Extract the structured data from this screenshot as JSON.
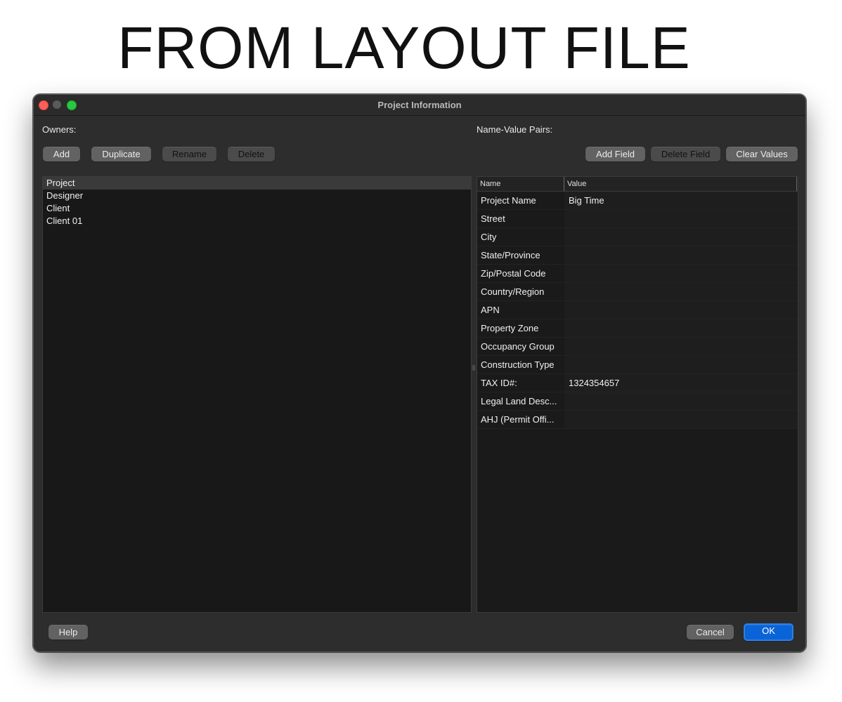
{
  "headline": "FROM LAYOUT FILE",
  "window": {
    "title": "Project Information"
  },
  "owners": {
    "label": "Owners:",
    "buttons": {
      "add": "Add",
      "duplicate": "Duplicate",
      "rename": "Rename",
      "delete": "Delete"
    },
    "items": [
      {
        "label": "Project",
        "selected": true
      },
      {
        "label": "Designer",
        "selected": false
      },
      {
        "label": "Client",
        "selected": false
      },
      {
        "label": "Client 01",
        "selected": false
      }
    ]
  },
  "name_value": {
    "label": "Name-Value Pairs:",
    "buttons": {
      "add_field": "Add Field",
      "delete_field": "Delete Field",
      "clear_values": "Clear Values"
    },
    "columns": {
      "name": "Name",
      "value": "Value"
    },
    "rows": [
      {
        "name": "Project Name",
        "value": "Big Time"
      },
      {
        "name": "Street",
        "value": ""
      },
      {
        "name": "City",
        "value": ""
      },
      {
        "name": "State/Province",
        "value": ""
      },
      {
        "name": "Zip/Postal Code",
        "value": ""
      },
      {
        "name": "Country/Region",
        "value": ""
      },
      {
        "name": "APN",
        "value": ""
      },
      {
        "name": "Property Zone",
        "value": ""
      },
      {
        "name": "Occupancy Group",
        "value": ""
      },
      {
        "name": "Construction Type",
        "value": ""
      },
      {
        "name": "TAX ID#:",
        "value": "1324354657"
      },
      {
        "name": "Legal Land Desc...",
        "value": ""
      },
      {
        "name": "AHJ (Permit Offi...",
        "value": ""
      }
    ]
  },
  "footer": {
    "help": "Help",
    "cancel": "Cancel",
    "ok": "OK"
  }
}
